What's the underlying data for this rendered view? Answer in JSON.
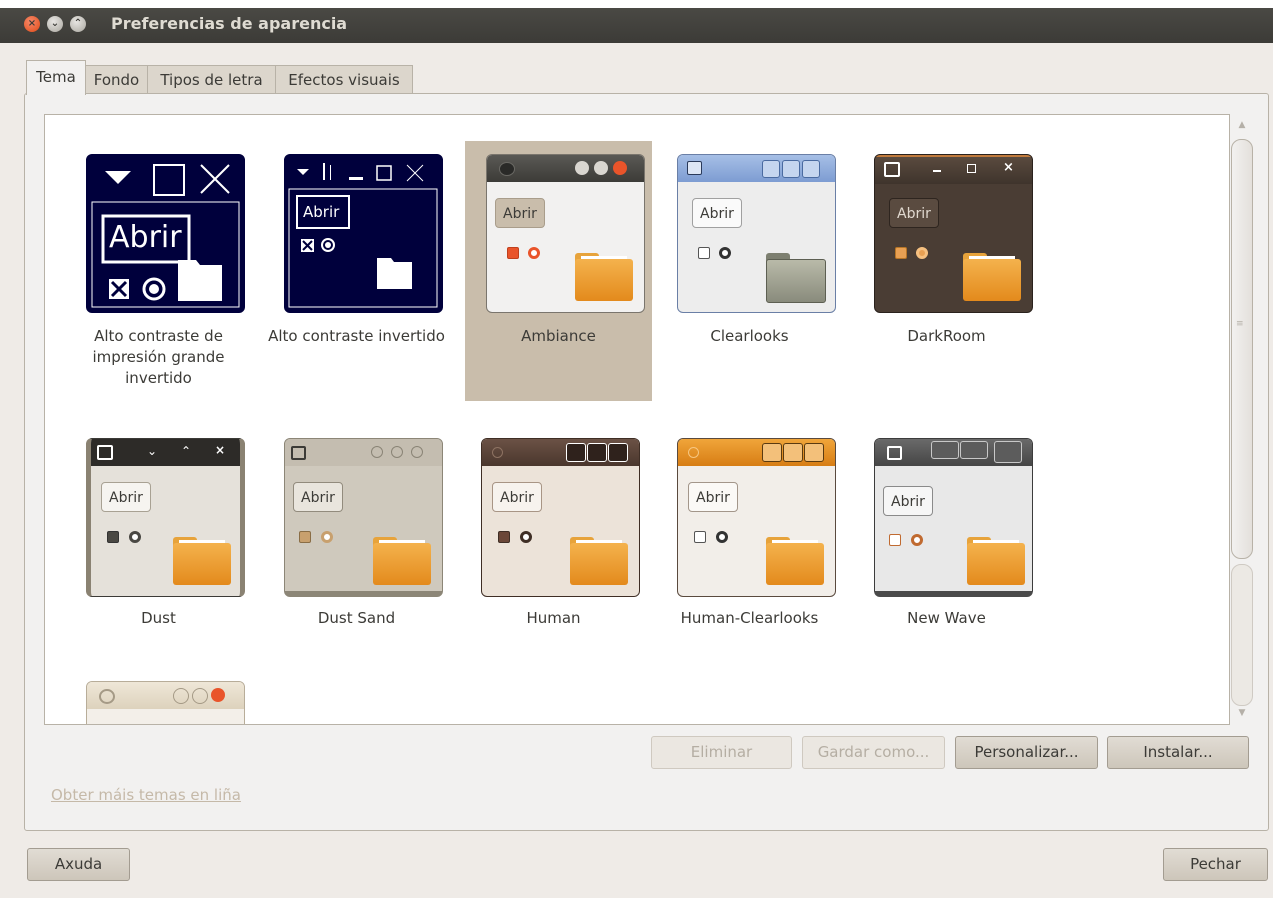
{
  "window": {
    "title": "Preferencias de aparencia",
    "controls": {
      "close_icon": "×",
      "minimize_icon": "⌄",
      "maximize_icon": "⌃"
    }
  },
  "tabs": [
    {
      "label": "Tema",
      "active": true
    },
    {
      "label": "Fondo",
      "active": false
    },
    {
      "label": "Tipos de letra",
      "active": false
    },
    {
      "label": "Efectos visuais",
      "active": false
    }
  ],
  "themes": [
    {
      "name": "Alto contraste de impresión grande invertido",
      "abrir": "Abrir"
    },
    {
      "name": "Alto contraste invertido",
      "abrir": "Abrir"
    },
    {
      "name": "Ambiance",
      "abrir": "Abrir",
      "selected": true
    },
    {
      "name": "Clearlooks",
      "abrir": "Abrir"
    },
    {
      "name": "DarkRoom",
      "abrir": "Abrir"
    },
    {
      "name": "Dust",
      "abrir": "Abrir"
    },
    {
      "name": "Dust Sand",
      "abrir": "Abrir"
    },
    {
      "name": "Human",
      "abrir": "Abrir"
    },
    {
      "name": "Human-Clearlooks",
      "abrir": "Abrir"
    },
    {
      "name": "New Wave",
      "abrir": "Abrir"
    },
    {
      "name": "",
      "abrir": ""
    }
  ],
  "actions": {
    "eliminar": "Eliminar",
    "gardar_como": "Gardar como...",
    "personalizar": "Personalizar...",
    "instalar": "Instalar..."
  },
  "more_themes_link": "Obter máis temas en liña",
  "footer": {
    "help": "Axuda",
    "close": "Pechar"
  },
  "colors": {
    "titlebar": "#3c3b37",
    "selection": "#c9bdab",
    "accent": "#df4a16"
  }
}
